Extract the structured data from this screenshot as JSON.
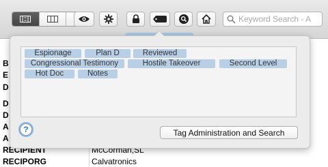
{
  "toolbar": {
    "view_modes": [
      {
        "icon": "grid-view-icon",
        "active": true
      },
      {
        "icon": "columns-view-icon",
        "active": false
      },
      {
        "icon": "list-view-icon",
        "active": false
      }
    ],
    "buttons": [
      "eye-icon",
      "gear-icon",
      "lock-icon",
      "tag-icon",
      "search-circle-icon",
      "home-icon"
    ],
    "search": {
      "placeholder": "Keyword Search - A"
    }
  },
  "tags_popover": {
    "tags": [
      "Espionage",
      "Plan D",
      "Reviewed",
      "Congressional Testimony",
      "Hostile Takeover",
      "Second Level",
      "Hot Doc",
      "Notes"
    ],
    "help_label": "?",
    "admin_button": "Tag Administration and Search"
  },
  "background_rows": [
    {
      "label": "B"
    },
    {
      "label": "E"
    },
    {
      "label": "D"
    },
    {
      "label": "D"
    },
    {
      "label": "D"
    },
    {
      "label": "A"
    },
    {
      "label": "A"
    },
    {
      "label": "RECIPIENT",
      "value": "McCorman,SL"
    },
    {
      "label": "RECIPORG",
      "value": "Calvatronics"
    }
  ],
  "colors": {
    "tag_bg": "#b8cfe6",
    "accent": "#2a7fd4"
  }
}
